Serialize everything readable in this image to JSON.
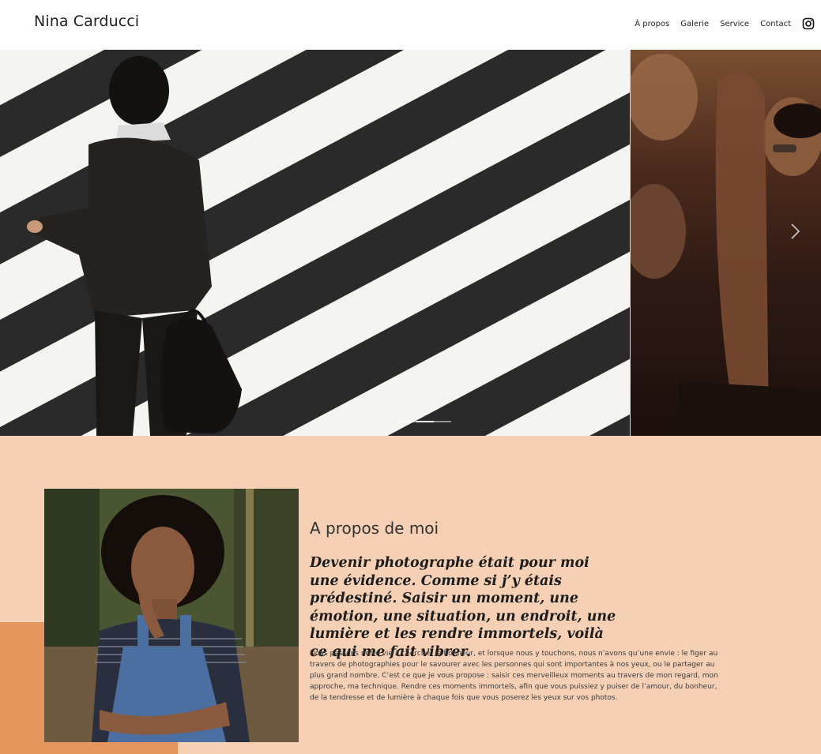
{
  "header": {
    "brand": "Nina Carducci",
    "nav": [
      "À propos",
      "Galerie",
      "Service",
      "Contact"
    ],
    "social_icon": "instagram-icon"
  },
  "hero": {
    "slides": [
      {
        "image": "businessman-crossing-crosswalk-photo"
      },
      {
        "image": "crowd-concert-photo"
      }
    ],
    "active_slide": 1,
    "next_icon": "chevron-right-icon"
  },
  "about": {
    "title": "A propos de moi",
    "lead": "Devenir photographe était pour moi une évidence. Comme si j’y étais prédestiné. Saisir un moment, une émotion, une situation, un endroit, une lumière et les rendre immortels, voilà ce qui me fait vibrer.",
    "body": "Nous passons notre vie à chercher le bonheur, et lorsque nous y touchons, nous n’avons qu’une envie : le figer au travers de photographies pour le savourer avec les personnes qui sont importantes à nos yeux, ou le partager au plus grand nombre. C’est ce que je vous propose : saisir ces merveilleux moments au travers de mon regard, mon approche, ma technique. Rendre ces moments immortels, afin que vous puissiez y puiser de l’amour, du bonheur, de la tendresse et de lumière à chaque fois que vous poserez les yeux sur vos photos.",
    "portrait": "woman-portrait-photo"
  },
  "colors": {
    "section_bg": "#f5d0b5",
    "accent": "#e5965f",
    "header_bg": "#ffffff"
  }
}
